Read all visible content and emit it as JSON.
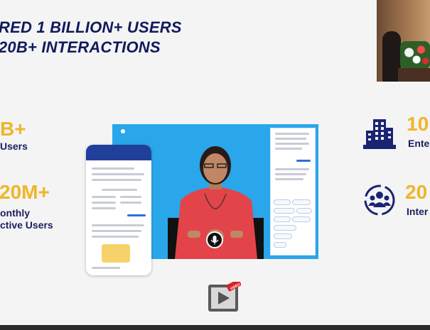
{
  "slide": {
    "headline_line1": "RED 1 BILLION+ USERS",
    "headline_line2": "20B+ INTERACTIONS",
    "left_stats": [
      {
        "value": "B+",
        "label": "Users"
      },
      {
        "value": "20M+",
        "label_line1": "onthly",
        "label_line2": "ctive Users"
      }
    ],
    "right_stats": [
      {
        "value": "10",
        "label": "Ente"
      },
      {
        "value": "20",
        "label": "Inter"
      }
    ],
    "icons": {
      "building": "office-building-icon",
      "users": "community-users-icon",
      "play": "video-play-icon",
      "mic": "microphone-icon"
    },
    "video_badge": "VIDEO",
    "colors": {
      "headline": "#101a5c",
      "stat_value": "#f0b52a",
      "stat_label": "#1a1f5e",
      "video_bg": "#2aa6ea"
    }
  }
}
